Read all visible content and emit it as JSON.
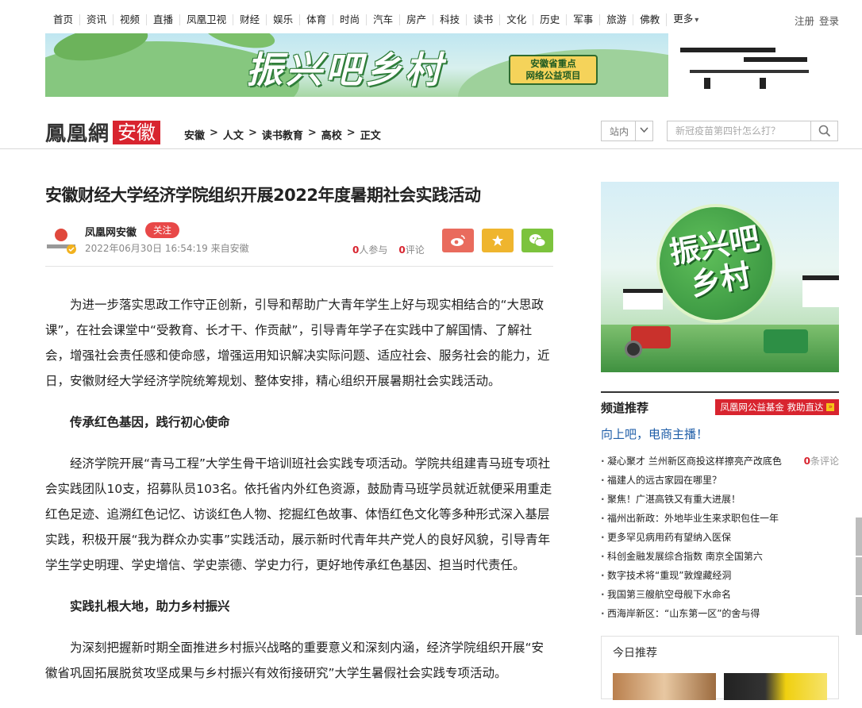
{
  "nav": {
    "items": [
      "首页",
      "资讯",
      "视频",
      "直播",
      "凤凰卫视",
      "财经",
      "娱乐",
      "体育",
      "时尚",
      "汽车",
      "房产",
      "科技",
      "读书",
      "文化",
      "历史",
      "军事",
      "旅游",
      "佛教"
    ],
    "more": "更多",
    "register": "注册",
    "login": "登录"
  },
  "banner": {
    "title": "振兴吧乡村",
    "badge_line1": "安徽省重点",
    "badge_line2": "网络公益项目"
  },
  "header": {
    "logo": "鳳凰網",
    "region": "安徽",
    "breadcrumb": [
      "安徽",
      "人文",
      "读书教育",
      "高校",
      "正文"
    ],
    "search_scope": "站内",
    "search_placeholder": "新冠疫苗第四针怎么打？"
  },
  "article": {
    "title": "安徽财经大学经济学院组织开展2022年度暑期社会实践活动",
    "source": "凤凰网安徽",
    "follow": "关注",
    "time": "2022年06月30日 16:54:19 来自安徽",
    "participants_count": "0",
    "participants_label": "人参与",
    "comments_count": "0",
    "comments_label": "评论",
    "paragraphs": [
      {
        "type": "p",
        "text": "为进一步落实思政工作守正创新，引导和帮助广大青年学生上好与现实相结合的“大思政课”，在社会课堂中“受教育、长才干、作贡献”，引导青年学子在实践中了解国情、了解社会，增强社会责任感和使命感，增强运用知识解决实际问题、适应社会、服务社会的能力，近日，安徽财经大学经济学院统筹规划、整体安排，精心组织开展暑期社会实践活动。"
      },
      {
        "type": "sub",
        "text": "传承红色基因，践行初心使命"
      },
      {
        "type": "p",
        "text": "经济学院开展“青马工程”大学生骨干培训班社会实践专项活动。学院共组建青马班专项社会实践团队10支，招募队员103名。依托省内外红色资源，鼓励青马班学员就近就便采用重走红色足迹、追溯红色记忆、访谈红色人物、挖掘红色故事、体悟红色文化等多种形式深入基层实践，积极开展“我为群众办实事”实践活动，展示新时代青年共产党人的良好风貌，引导青年学生学史明理、学史增信、学史崇德、学史力行，更好地传承红色基因、担当时代责任。"
      },
      {
        "type": "sub",
        "text": "实践扎根大地，助力乡村振兴"
      },
      {
        "type": "p",
        "text": "为深刻把握新时期全面推进乡村振兴战略的重要意义和深刻内涵，经济学院组织开展“安徽省巩固拓展脱贫攻坚成果与乡村振兴有效衔接研究”大学生暑假社会实践专项活动。"
      }
    ]
  },
  "sidebar": {
    "promo_text": "振兴吧乡村",
    "channel_title": "频道推荐",
    "channel_tag": "凤凰网公益基金 救助直达",
    "lead": "向上吧，电商主播！",
    "comment_count": "0",
    "comment_label": "条评论",
    "items": [
      "凝心聚才 兰州新区商投这样擦亮产改底色",
      "福建人的远古家园在哪里？",
      "聚焦！广湛高铁又有重大进展！",
      "福州出新政：外地毕业生来求职包住一年",
      "更多罕见病用药有望纳入医保",
      "科创金融发展综合指数 南京全国第六",
      "数字技术将“重现”敦煌藏经洞",
      "我国第三艘航空母舰下水命名",
      "西海岸新区：“山东第一区”的舍与得"
    ],
    "today_title": "今日推荐"
  },
  "colors": {
    "accent_red": "#d8242f",
    "link_blue": "#1f5ea8",
    "weibo": "#e96b5d",
    "favorite": "#efb52e",
    "wechat": "#7cc33d"
  }
}
